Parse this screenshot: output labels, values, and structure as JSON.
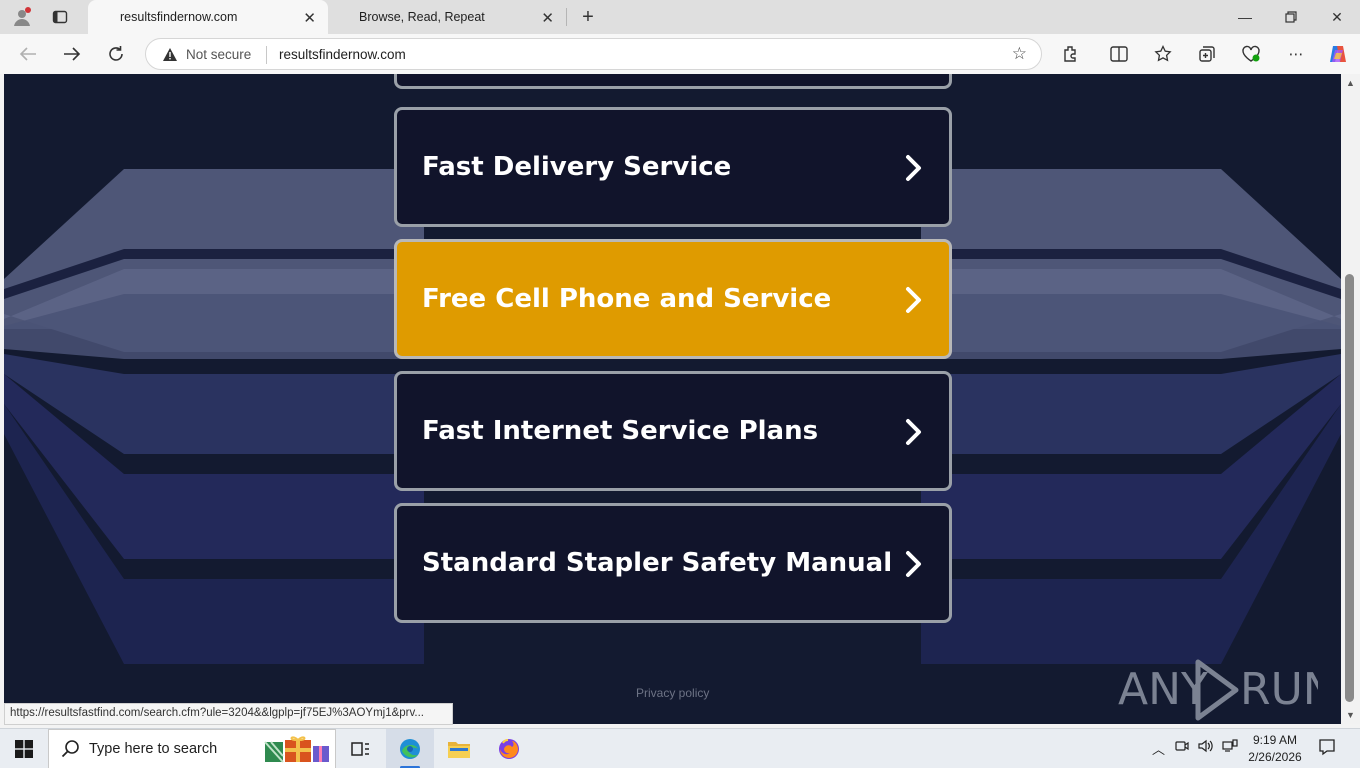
{
  "browser": {
    "tabs": [
      {
        "title": "resultsfindernow.com",
        "active": true
      },
      {
        "title": "Browse, Read, Repeat",
        "active": false
      }
    ],
    "address": {
      "security_label": "Not secure",
      "url": "resultsfindernow.com"
    }
  },
  "page": {
    "buttons": [
      {
        "label": "Fast Delivery Service",
        "highlighted": false
      },
      {
        "label": "Free Cell Phone and Service",
        "highlighted": true
      },
      {
        "label": "Fast Internet Service Plans",
        "highlighted": false
      },
      {
        "label": "Standard Stapler Safety Manual",
        "highlighted": false
      }
    ],
    "footer_link": "Privacy policy",
    "watermark": "ANY RUN",
    "colors": {
      "background": "#131a30",
      "button_highlight": "#df9b00",
      "button_default": "#11142b"
    }
  },
  "status_url": "https://resultsfastfind.com/search.cfm?ule=3204&&lgplp=jf75EJ%3AOYmj1&prv...",
  "taskbar": {
    "search_placeholder": "Type here to search",
    "time": "9:19 AM",
    "date": "2/26/2026"
  }
}
